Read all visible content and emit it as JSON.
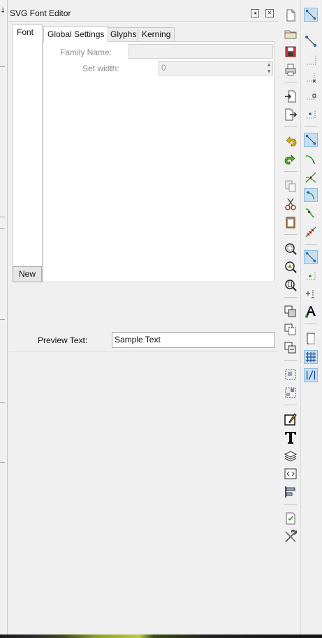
{
  "panel": {
    "title": "SVG Font Editor",
    "iconify_glyph": "◂",
    "close_glyph": "✕"
  },
  "font_list": {
    "header": "Font",
    "new_button": "New"
  },
  "tabs": [
    {
      "label": "Global Settings",
      "active": true
    },
    {
      "label": "Glyphs",
      "active": false
    },
    {
      "label": "Kerning",
      "active": false
    }
  ],
  "global_settings": {
    "family_name_label": "Family Name:",
    "family_name_value": "",
    "set_width_label": "Set width:",
    "set_width_value": "0"
  },
  "preview": {
    "label": "Preview Text:",
    "value": "Sample Text"
  },
  "toolbars": {
    "commands": [
      "new-document",
      "open-file",
      "save-file",
      "print",
      "import",
      "export",
      "undo",
      "redo",
      "copy",
      "cut",
      "paste",
      "zoom",
      "zoom-drawing",
      "zoom-page",
      "duplicate",
      "clone",
      "unlink-clone",
      "group",
      "ungroup",
      "fill-stroke",
      "text",
      "layers",
      "xml-editor",
      "align-distribute",
      "document-properties",
      "preferences"
    ],
    "snap": [
      "snap-enable",
      "snap-bbox",
      "snap-bbox-edges",
      "snap-bbox-corners",
      "snap-bbox-midpoints",
      "snap-bbox-centers",
      "snap-nodes",
      "snap-paths",
      "snap-intersections",
      "snap-cusp-nodes",
      "snap-smooth-nodes",
      "snap-line-midpoints",
      "snap-others",
      "snap-object-centers",
      "snap-rotation-center",
      "snap-text-baseline",
      "snap-page-border",
      "snap-grids",
      "snap-guides"
    ]
  },
  "colors": {
    "panel_bg": "#f0f0f0",
    "active_toggle": "#c6dff3",
    "undo_yellow": "#d9a300",
    "redo_green": "#3c8c2c"
  }
}
